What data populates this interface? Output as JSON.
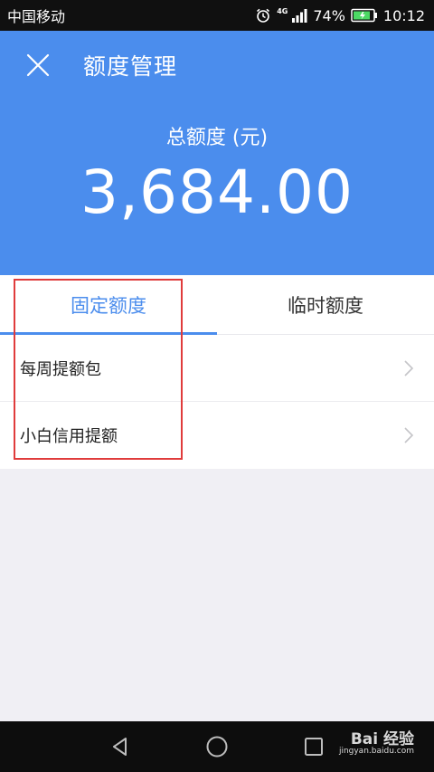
{
  "status_bar": {
    "carrier": "中国移动",
    "network": "4G",
    "battery": "74%",
    "time": "10:12",
    "icons": [
      "alarm-icon",
      "signal-icon",
      "battery-icon"
    ]
  },
  "header": {
    "title": "额度管理",
    "total_label": "总额度 (元)",
    "total_amount": "3,684.00",
    "background_color": "#4b8ded"
  },
  "tabs": [
    {
      "label": "固定额度",
      "active": true
    },
    {
      "label": "临时额度",
      "active": false
    }
  ],
  "list": {
    "items": [
      {
        "label": "每周提额包"
      },
      {
        "label": "小白信用提额"
      }
    ]
  },
  "nav_bar": {
    "buttons": [
      "back-icon",
      "home-icon",
      "recents-icon"
    ]
  },
  "watermark": {
    "main": "Bai 经验",
    "sub": "jingyan.baidu.com"
  },
  "colors": {
    "accent": "#4b8ded",
    "highlight_box": "#e03c3c"
  }
}
